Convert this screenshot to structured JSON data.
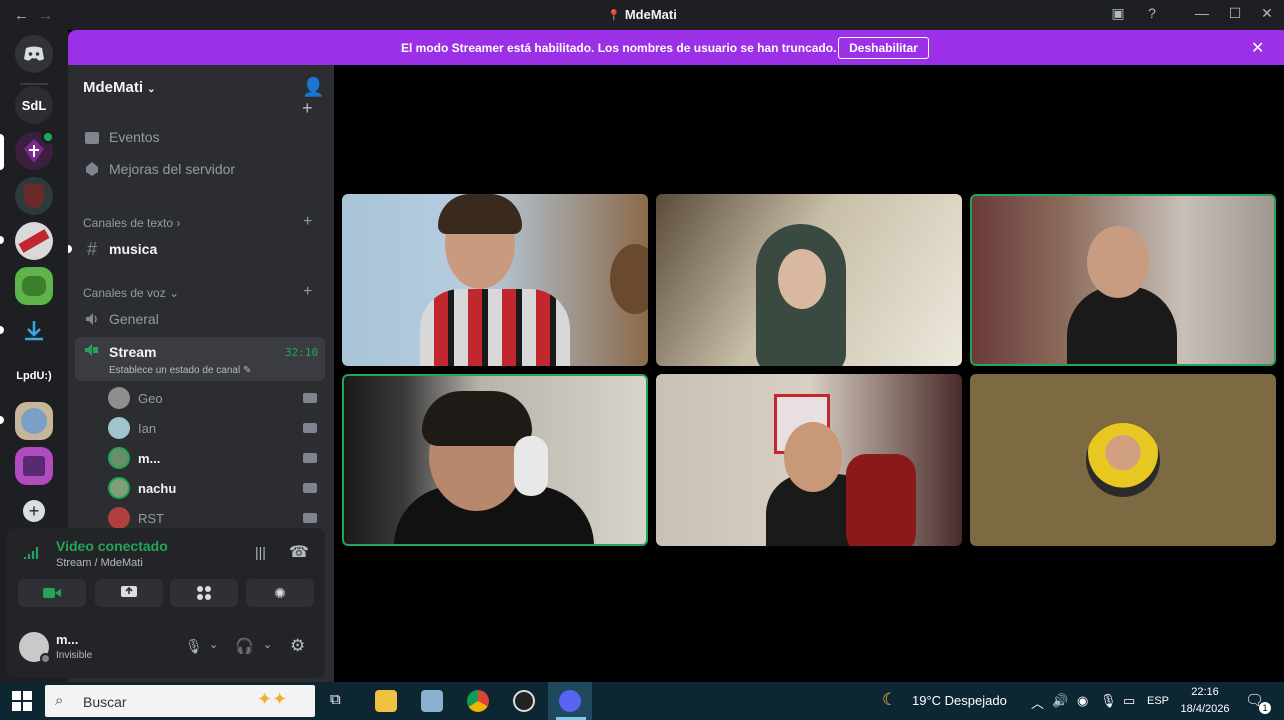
{
  "window": {
    "title": "MdeMati"
  },
  "banner": {
    "message": "El modo Streamer está habilitado. Los nombres de usuario se han truncado.",
    "button": "Deshabilitar"
  },
  "guilds": {
    "sdl": "SdL",
    "lpdu": "LpdU:)"
  },
  "server": {
    "name": "MdeMati",
    "events": "Eventos",
    "boosts": "Mejoras del servidor",
    "text_category": "Canales de texto",
    "text_channel": "musica",
    "voice_category": "Canales de voz",
    "voice_general": "General",
    "stream_channel": "Stream",
    "stream_timer": "32:10",
    "stream_status": "Establece un estado de canal",
    "voice_users": [
      {
        "name": "Geo",
        "color": "#8e8e8e"
      },
      {
        "name": "Ian",
        "color": "#9fc4cf"
      },
      {
        "name": "m...",
        "color": "#6a8e6a",
        "speaking": true
      },
      {
        "name": "nachu",
        "color": "#7fa07a",
        "speaking": true
      },
      {
        "name": "RST",
        "color": "#b04040"
      }
    ]
  },
  "voice_panel": {
    "status": "Video conectado",
    "channel": "Stream / MdeMati"
  },
  "user_panel": {
    "name": "m...",
    "status": "Invisible"
  },
  "taskbar": {
    "search_placeholder": "Buscar",
    "weather": "19°C  Despejado",
    "lang": "ESP",
    "time": "22:16",
    "date": "18/4/2026",
    "notif_count": "1"
  },
  "colors": {
    "accent_banner": "#9b30e6",
    "speaking_green": "#23a559",
    "sidebar_bg": "#2b2d31"
  }
}
